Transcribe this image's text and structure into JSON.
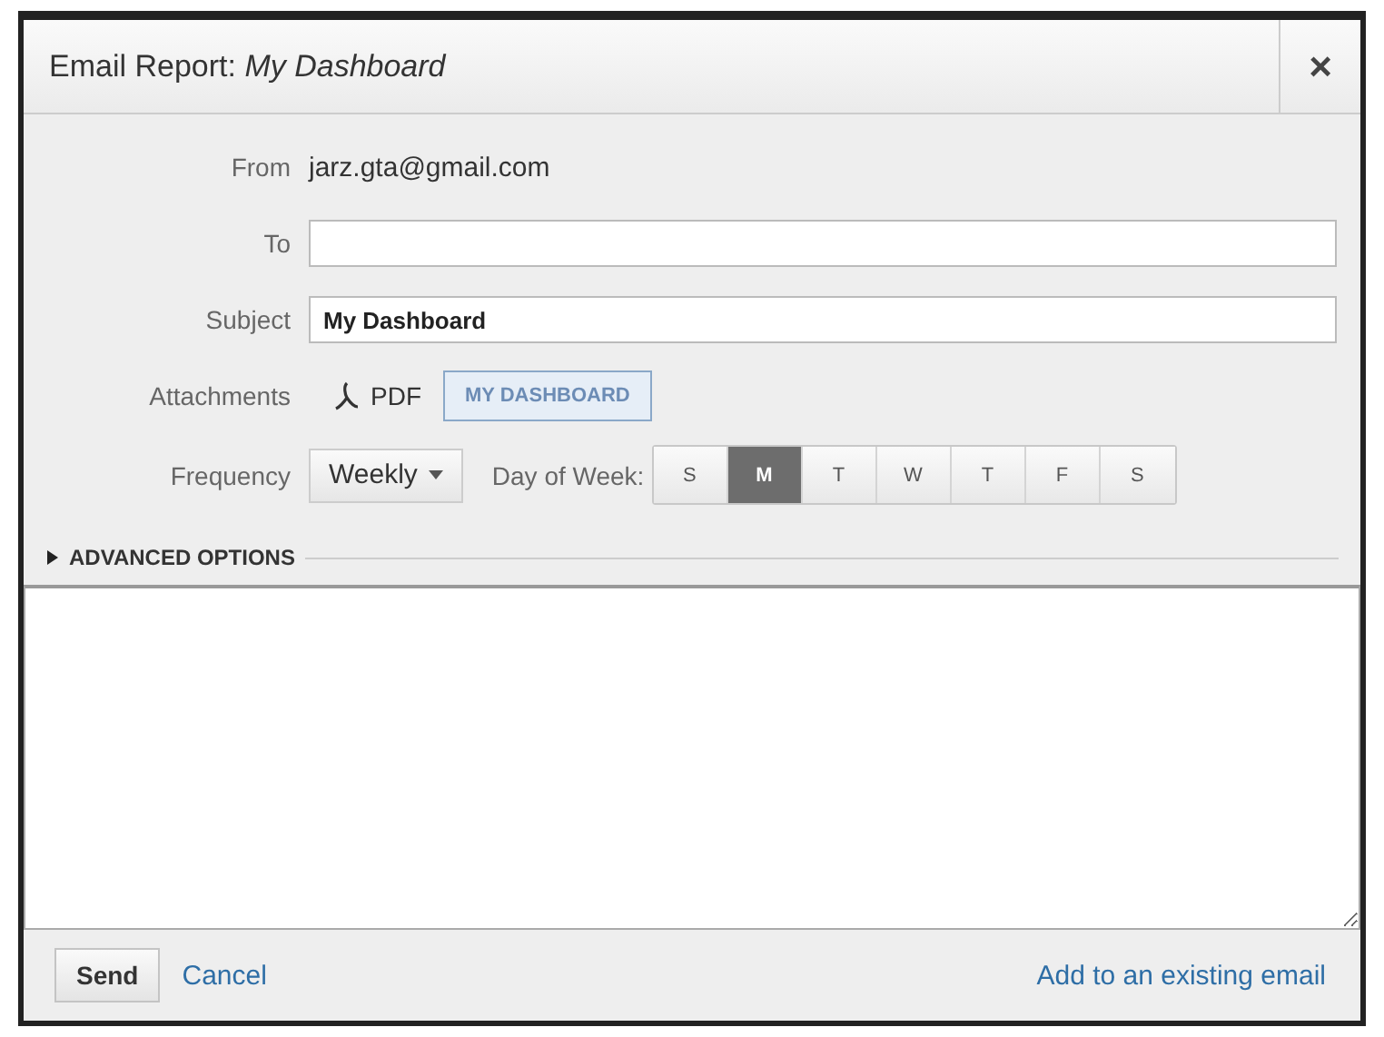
{
  "dialog": {
    "title": "Email Report: *My Dashboard*",
    "close": "×"
  },
  "form": {
    "from_label": "From",
    "from_value": "jarz.gta@gmail.com",
    "to_label": "To",
    "subject_label": "Subject",
    "subject_value": "My Dashboard",
    "attachments_label": "Attachments",
    "attachment_format": "PDF",
    "attachment_name": "MY DASHBOARD",
    "frequency_label": "Frequency",
    "frequency_value": "Weekly",
    "day_label": "Day of Week:",
    "days": [
      {
        "label": "S",
        "selected": false
      },
      {
        "label": "M",
        "selected": true
      },
      {
        "label": "T",
        "selected": false
      },
      {
        "label": "W",
        "selected": false
      },
      {
        "label": "T",
        "selected": false
      },
      {
        "label": "F",
        "selected": false
      },
      {
        "label": "S",
        "selected": false
      }
    ]
  },
  "advanced": {
    "label": "ADVANCED OPTIONS",
    "expanded": false
  },
  "footer": {
    "send": "Send",
    "cancel": "Cancel",
    "add_existing": "Add to an existing email"
  }
}
